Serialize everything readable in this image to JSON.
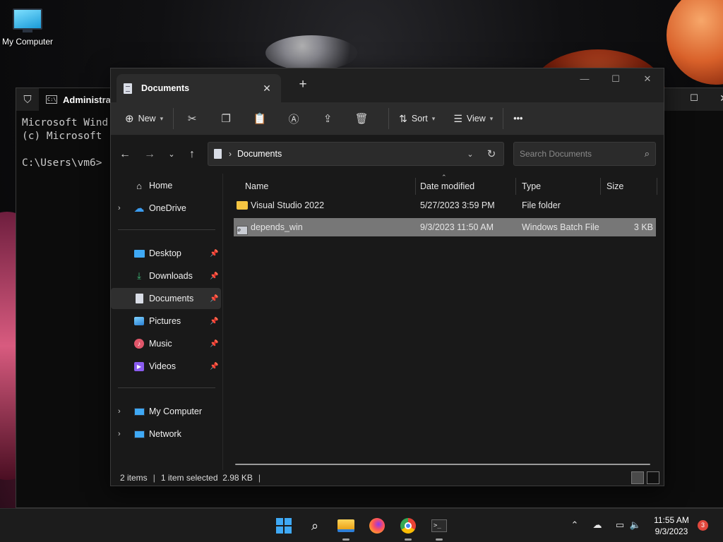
{
  "desktop": {
    "icon_label": "My Computer"
  },
  "cmd": {
    "title": "Administrat",
    "lines": [
      "Microsoft Wind",
      "(c) Microsoft ",
      "",
      "C:\\Users\\vm6>"
    ]
  },
  "explorer": {
    "tab_title": "Documents",
    "toolbar": {
      "new_label": "New",
      "sort_label": "Sort",
      "view_label": "View",
      "more_label": "•••"
    },
    "address": {
      "path": "Documents"
    },
    "search": {
      "placeholder": "Search Documents"
    },
    "nav": {
      "home": "Home",
      "onedrive": "OneDrive",
      "desktop": "Desktop",
      "downloads": "Downloads",
      "documents": "Documents",
      "pictures": "Pictures",
      "music": "Music",
      "videos": "Videos",
      "my_computer": "My Computer",
      "network": "Network"
    },
    "columns": {
      "name": "Name",
      "date": "Date modified",
      "type": "Type",
      "size": "Size"
    },
    "files": [
      {
        "name": "Visual Studio 2022",
        "date": "5/27/2023 3:59 PM",
        "type": "File folder",
        "size": ""
      },
      {
        "name": "depends_win",
        "date": "9/3/2023 11:50 AM",
        "type": "Windows Batch File",
        "size": "3 KB"
      }
    ],
    "status": {
      "count": "2 items",
      "selection": "1 item selected  2.98 KB"
    }
  },
  "taskbar": {
    "time": "11:55 AM",
    "date": "9/3/2023",
    "notifications": "3"
  }
}
